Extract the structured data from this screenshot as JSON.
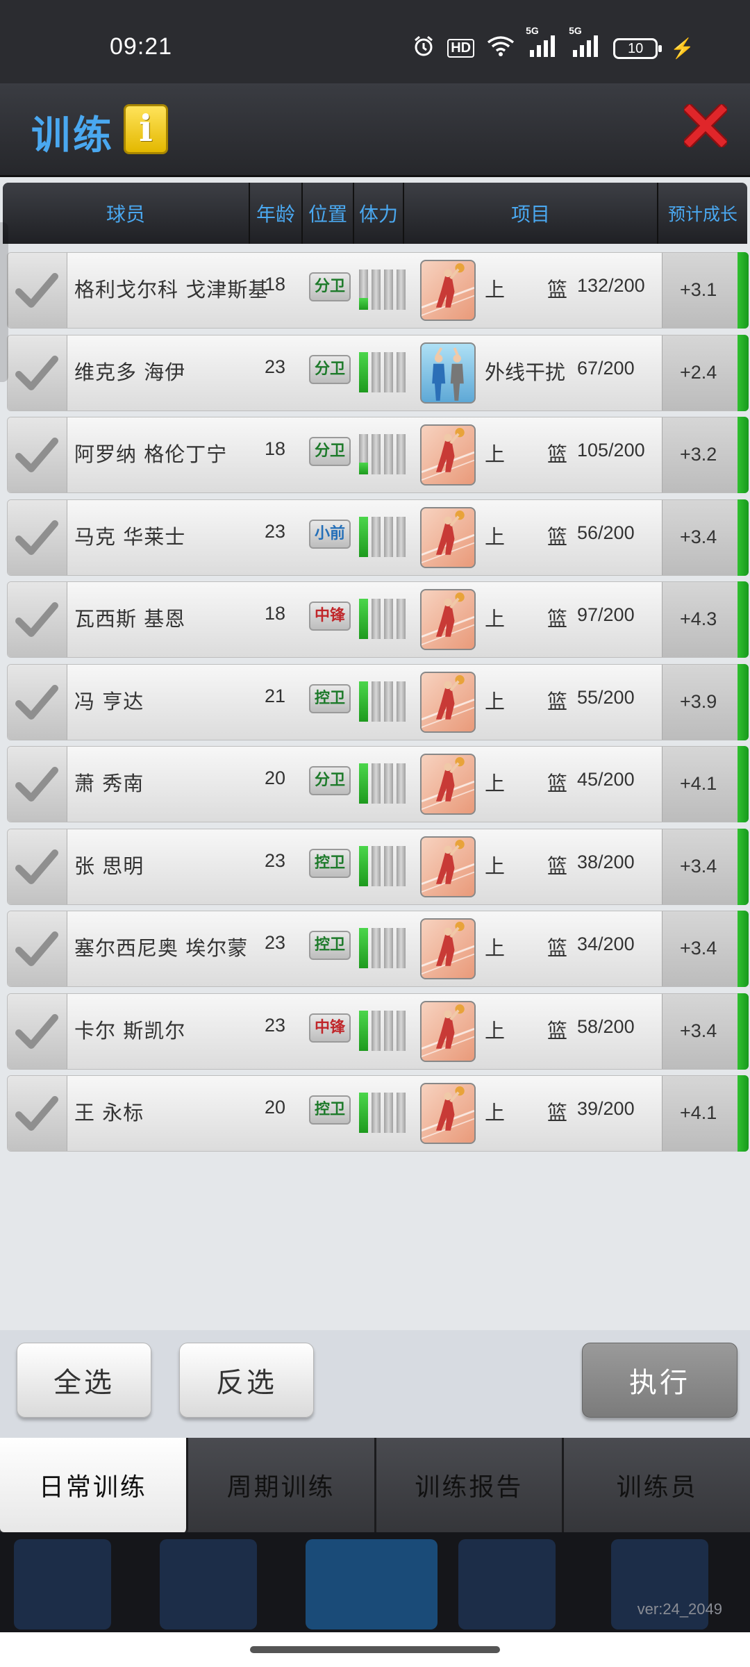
{
  "status_bar": {
    "time": "09:21",
    "icons": [
      "alarm-icon",
      "hd-icon",
      "wifi-icon",
      "5g-signal-icon",
      "5g-signal-icon"
    ],
    "hd_label": "HD",
    "net1": "5G",
    "net2": "5G",
    "battery": "10"
  },
  "header": {
    "title": "训练",
    "info_label": "i"
  },
  "table": {
    "headers": {
      "player": "球员",
      "age": "年龄",
      "position": "位置",
      "stamina": "体力",
      "item": "项目",
      "growth": "预计成长"
    },
    "rows": [
      {
        "name": "格利戈尔科 戈津斯基",
        "age": "18",
        "pos": "分卫",
        "pos_color": "green",
        "stamina": 1,
        "icon": "shoot",
        "skill_a": "上",
        "skill_b": "篮",
        "progress": "132/200",
        "growth": "+3.1"
      },
      {
        "name": "维克多 海伊",
        "age": "23",
        "pos": "分卫",
        "pos_color": "green",
        "stamina": 2,
        "icon": "defend",
        "skill_a": "外线干扰",
        "skill_b": "",
        "progress": "67/200",
        "growth": "+2.4"
      },
      {
        "name": "阿罗纳 格伦丁宁",
        "age": "18",
        "pos": "分卫",
        "pos_color": "green",
        "stamina": 1,
        "icon": "shoot",
        "skill_a": "上",
        "skill_b": "篮",
        "progress": "105/200",
        "growth": "+3.2"
      },
      {
        "name": "马克 华莱士",
        "age": "23",
        "pos": "小前",
        "pos_color": "blue",
        "stamina": 2,
        "icon": "shoot",
        "skill_a": "上",
        "skill_b": "篮",
        "progress": "56/200",
        "growth": "+3.4"
      },
      {
        "name": "瓦西斯 基恩",
        "age": "18",
        "pos": "中锋",
        "pos_color": "red",
        "stamina": 2,
        "icon": "shoot",
        "skill_a": "上",
        "skill_b": "篮",
        "progress": "97/200",
        "growth": "+4.3"
      },
      {
        "name": "冯 亨达",
        "age": "21",
        "pos": "控卫",
        "pos_color": "green",
        "stamina": 2,
        "icon": "shoot",
        "skill_a": "上",
        "skill_b": "篮",
        "progress": "55/200",
        "growth": "+3.9"
      },
      {
        "name": "萧 秀南",
        "age": "20",
        "pos": "分卫",
        "pos_color": "green",
        "stamina": 2,
        "icon": "shoot",
        "skill_a": "上",
        "skill_b": "篮",
        "progress": "45/200",
        "growth": "+4.1"
      },
      {
        "name": "张 思明",
        "age": "23",
        "pos": "控卫",
        "pos_color": "green",
        "stamina": 2,
        "icon": "shoot",
        "skill_a": "上",
        "skill_b": "篮",
        "progress": "38/200",
        "growth": "+3.4"
      },
      {
        "name": "塞尔西尼奥 埃尔蒙",
        "age": "23",
        "pos": "控卫",
        "pos_color": "green",
        "stamina": 2,
        "icon": "shoot",
        "skill_a": "上",
        "skill_b": "篮",
        "progress": "34/200",
        "growth": "+3.4"
      },
      {
        "name": "卡尔 斯凯尔",
        "age": "23",
        "pos": "中锋",
        "pos_color": "red",
        "stamina": 2,
        "icon": "shoot",
        "skill_a": "上",
        "skill_b": "篮",
        "progress": "58/200",
        "growth": "+3.4"
      },
      {
        "name": "王 永标",
        "age": "20",
        "pos": "控卫",
        "pos_color": "green",
        "stamina": 2,
        "icon": "shoot",
        "skill_a": "上",
        "skill_b": "篮",
        "progress": "39/200",
        "growth": "+4.1"
      }
    ]
  },
  "actions": {
    "select_all": "全选",
    "invert_select": "反选",
    "execute": "执行"
  },
  "tabs": [
    {
      "label": "日常训练",
      "active": true
    },
    {
      "label": "周期训练",
      "active": false
    },
    {
      "label": "训练报告",
      "active": false
    },
    {
      "label": "训练员",
      "active": false
    }
  ],
  "footer": {
    "version": "ver:24_2049"
  },
  "colors": {
    "accent_blue": "#4aa8f0",
    "stamina_green": "#2fb52f",
    "close_red": "#e0262a",
    "info_yellow": "#f5cc1e"
  }
}
